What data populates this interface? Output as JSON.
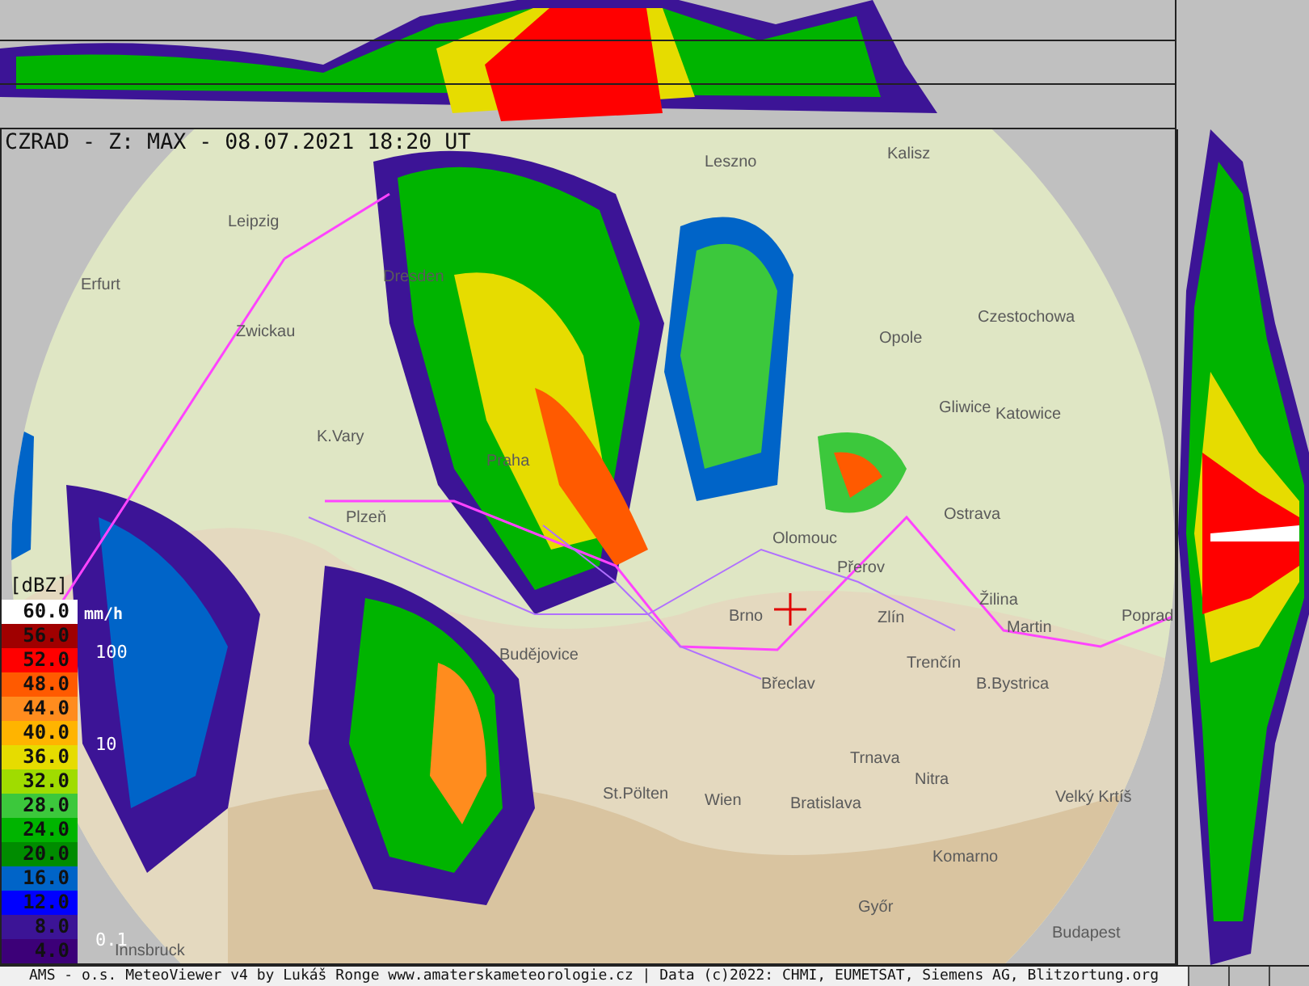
{
  "title": "CZRAD - Z: MAX - 08.07.2021 18:20 UT",
  "legend": {
    "unit": "[dBZ]",
    "items": [
      {
        "label": "60.0",
        "color": "#ffffff"
      },
      {
        "label": "56.0",
        "color": "#a00000"
      },
      {
        "label": "52.0",
        "color": "#ff0000"
      },
      {
        "label": "48.0",
        "color": "#ff5a00"
      },
      {
        "label": "44.0",
        "color": "#ff8c1e"
      },
      {
        "label": "40.0",
        "color": "#ffb400"
      },
      {
        "label": "36.0",
        "color": "#e6dc00"
      },
      {
        "label": "32.0",
        "color": "#a0dc00"
      },
      {
        "label": "28.0",
        "color": "#3cc83c"
      },
      {
        "label": "24.0",
        "color": "#00b400"
      },
      {
        "label": "20.0",
        "color": "#008c00"
      },
      {
        "label": "16.0",
        "color": "#0064c8"
      },
      {
        "label": "12.0",
        "color": "#0000ff"
      },
      {
        "label": "8.0",
        "color": "#3c1496"
      },
      {
        "label": "4.0",
        "color": "#3c0078"
      }
    ]
  },
  "rain_scale": {
    "unit": "mm/h",
    "marks": [
      "100",
      "10",
      "0.1"
    ]
  },
  "map_labels": [
    "Leszno",
    "Kalisz",
    "Leipzig",
    "Erfurt",
    "Dresden",
    "Zwickau",
    "Czestochowa",
    "Opole",
    "Gliwice",
    "Katowice",
    "K.Vary",
    "Plzeň",
    "Praha",
    "Olomouc",
    "Přerov",
    "Ostrava",
    "Brno",
    "Zlín",
    "Žilina",
    "Martin",
    "Poprad",
    "Trenčín",
    "B.Bystrica",
    "Břeclav",
    "Budějovice",
    "Trnava",
    "Nitra",
    "St.Pölten",
    "Wien",
    "Bratislava",
    "Velký Krtíš",
    "Komarno",
    "Győr",
    "Budapest",
    "Innsbruck"
  ],
  "footer": "AMS - o.s. MeteoViewer v4 by Lukáš Ronge www.amaterskameteorologie.cz | Data (c)2022: CHMI, EUMETSAT, Siemens AG, Blitzortung.org"
}
